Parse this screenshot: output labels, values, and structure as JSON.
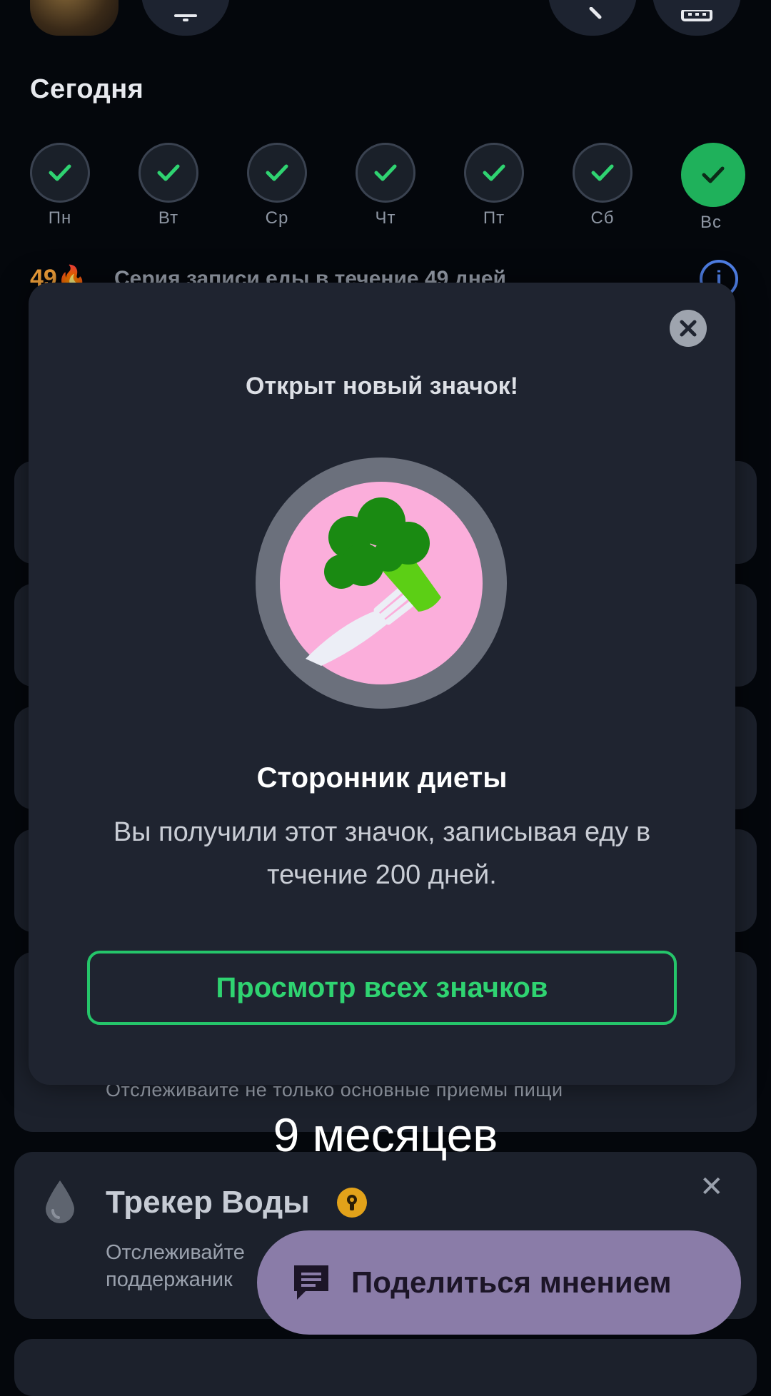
{
  "header": {
    "today_title": "Сегодня"
  },
  "week": [
    {
      "label": "Пн",
      "done": true,
      "active": false
    },
    {
      "label": "Вт",
      "done": true,
      "active": false
    },
    {
      "label": "Ср",
      "done": true,
      "active": false
    },
    {
      "label": "Чт",
      "done": true,
      "active": false
    },
    {
      "label": "Пт",
      "done": true,
      "active": false
    },
    {
      "label": "Сб",
      "done": true,
      "active": false
    },
    {
      "label": "Вс",
      "done": true,
      "active": true
    }
  ],
  "streak": {
    "count": "49",
    "text": "Серия записи еды в течение 49 дней"
  },
  "background_cards": {
    "snack_subtitle": "Отслеживайте не только основные приемы пищи",
    "water": {
      "title": "Трекер Воды",
      "desc_line1": "Отслеживайте",
      "desc_line2": "поддержаник"
    }
  },
  "modal": {
    "title": "Открыт новый значок!",
    "badge_name": "Сторонник диеты",
    "badge_desc": "Вы получили этот значок, записывая еду в течение 200 дней.",
    "view_all_label": "Просмотр всех значков"
  },
  "overlay_caption": "9 месяцев",
  "feedback_button": {
    "label": "Поделиться мнением"
  },
  "colors": {
    "accent_green": "#25c56a",
    "streak_orange": "#f2a13a",
    "feedback_purple": "#8a7ca8",
    "info_blue": "#4f7fe6"
  }
}
